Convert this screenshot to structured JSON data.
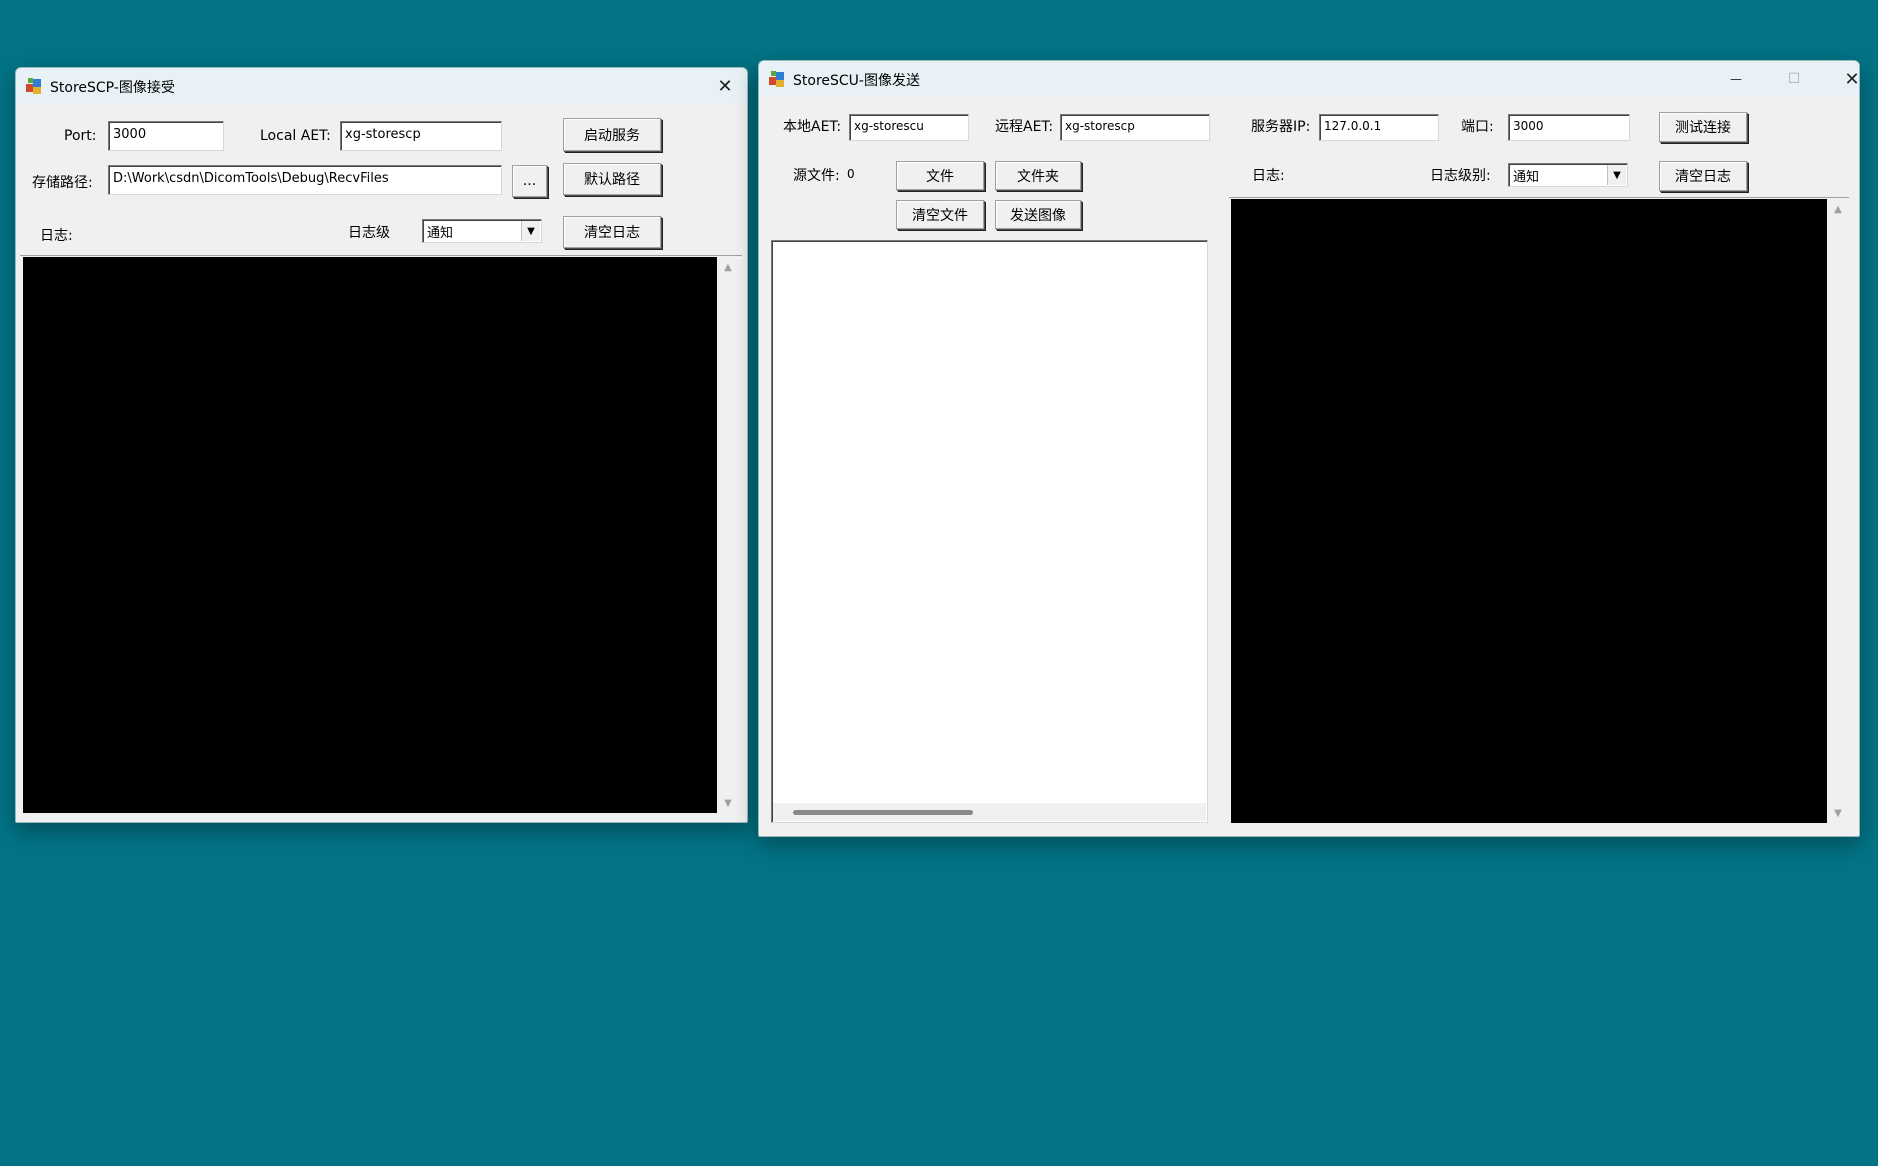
{
  "scp": {
    "title": "StoreSCP-图像接受",
    "port_label": "Port:",
    "port_value": "3000",
    "aet_label": "Local AET:",
    "aet_value": "xg-storescp",
    "start_button": "启动服务",
    "path_label": "存储路径:",
    "path_value": "D:\\Work\\csdn\\DicomTools\\Debug\\RecvFiles",
    "browse_button": "...",
    "default_path_button": "默认路径",
    "log_label": "日志:",
    "log_level_label": "日志级",
    "log_level_value": "通知",
    "clear_log_button": "清空日志"
  },
  "scu": {
    "title": "StoreSCU-图像发送",
    "local_aet_label": "本地AET:",
    "local_aet_value": "xg-storescu",
    "remote_aet_label": "远程AET:",
    "remote_aet_value": "xg-storescp",
    "server_ip_label": "服务器IP:",
    "server_ip_value": "127.0.0.1",
    "port_label": "端口:",
    "port_value": "3000",
    "test_button": "测试连接",
    "source_files_label": "源文件:",
    "source_files_count": "0",
    "file_button": "文件",
    "folder_button": "文件夹",
    "clear_files_button": "清空文件",
    "send_button": "发送图像",
    "log_label": "日志:",
    "log_level_label": "日志级别:",
    "log_level_value": "通知",
    "clear_log_button": "清空日志"
  },
  "icons": {
    "close": "✕",
    "minimize": "—",
    "maximize": "☐",
    "dropdown": "▼",
    "scroll_up": "▲",
    "scroll_down": "▼"
  },
  "colors": {
    "desktop": "#027486",
    "log_background": "#000000"
  }
}
